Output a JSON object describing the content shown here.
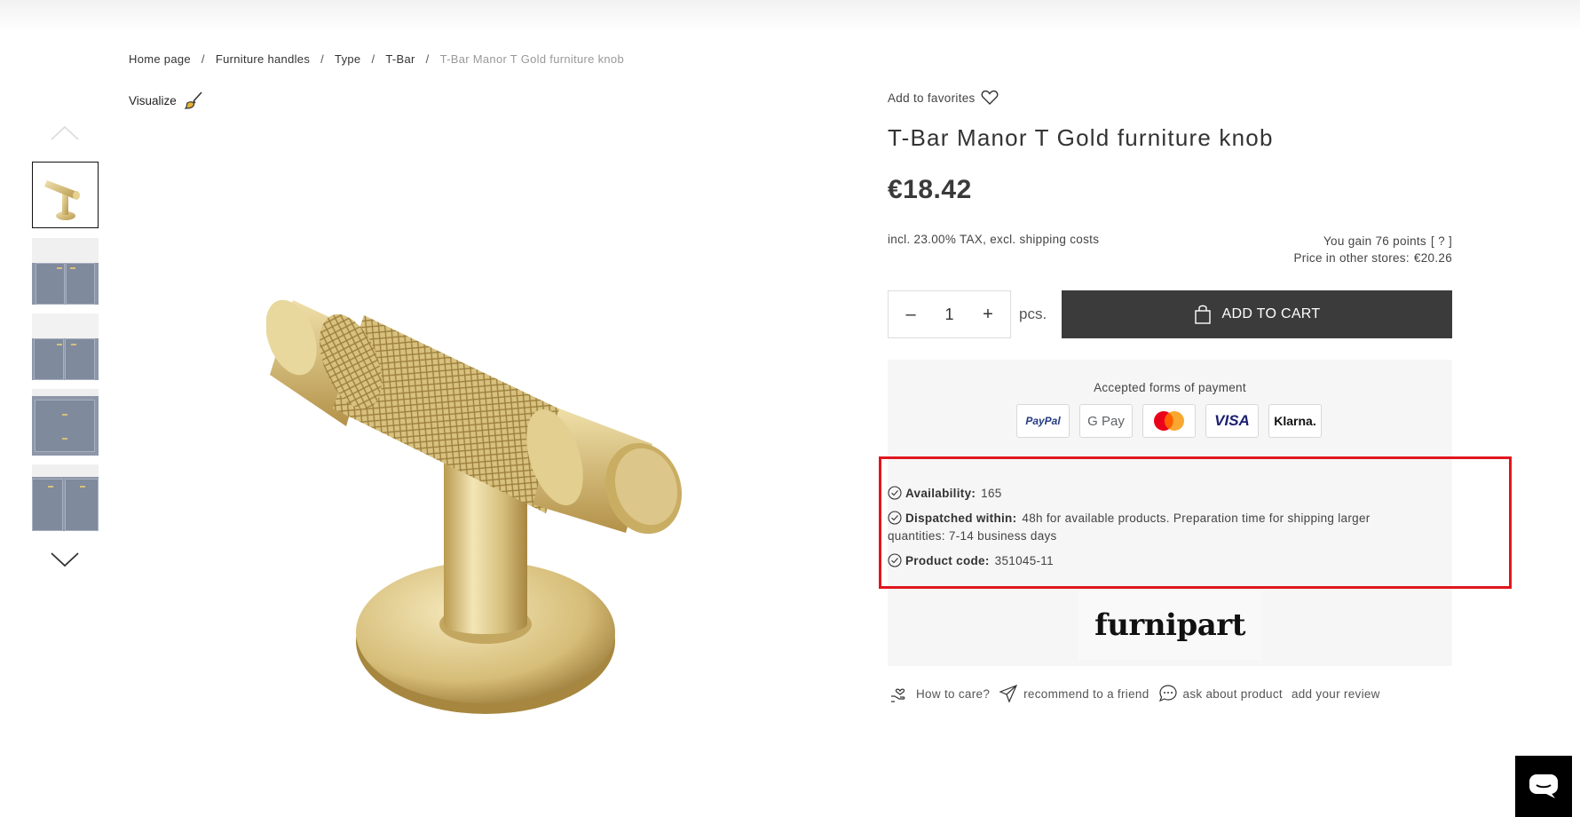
{
  "breadcrumb": {
    "items": [
      "Home page",
      "Furniture handles",
      "Type",
      "T-Bar"
    ],
    "separator": "/",
    "current": "T-Bar Manor T Gold furniture knob"
  },
  "gallery": {
    "visualize_label": "Visualize",
    "thumbnails": [
      "product-knob",
      "kitchen-cabinet-1",
      "kitchen-cabinet-2",
      "cabinet-doors",
      "cabinet-drawer"
    ]
  },
  "product": {
    "add_favorites": "Add to favorites",
    "title": "T-Bar Manor T Gold furniture knob",
    "price": "€18.42",
    "tax_note": "incl. 23.00% TAX, excl. shipping costs",
    "points_text": "You gain 76 points",
    "points_help": "[ ? ]",
    "other_stores_label": "Price in other stores:",
    "other_stores_price": "€20.26"
  },
  "cart": {
    "minus": "–",
    "quantity": "1",
    "plus": "+",
    "unit": "pcs.",
    "add_label": "ADD TO CART"
  },
  "payment": {
    "label": "Accepted forms of payment",
    "methods": [
      "PayPal",
      "G Pay",
      "Mastercard",
      "VISA",
      "Klarna."
    ]
  },
  "info": {
    "availability_label": "Availability:",
    "availability_value": "165",
    "dispatch_label": "Dispatched within:",
    "dispatch_value": "48h for available products. Preparation time for shipping larger",
    "dispatch_value_2": "quantities: 7-14 business days",
    "code_label": "Product code:",
    "code_value": "351045-11"
  },
  "brand": {
    "name": "furnipart"
  },
  "actions": {
    "care": "How to care?",
    "recommend": "recommend to a friend",
    "ask": "ask about product",
    "review": "add your review"
  },
  "colors": {
    "accent_dark": "#3b3b3b",
    "highlight": "#e0161d",
    "gold": "#d4bd7a"
  }
}
